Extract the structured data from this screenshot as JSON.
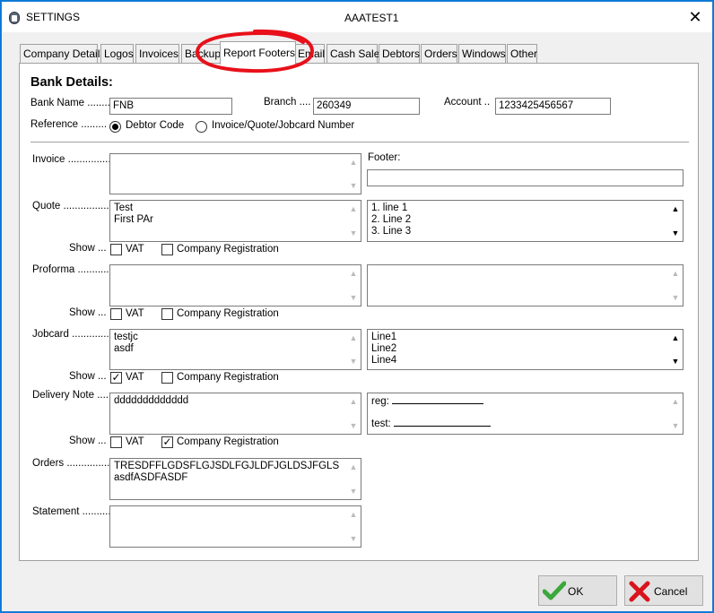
{
  "window": {
    "title": "SETTINGS",
    "company": "AAATEST1",
    "close_glyph": "✕"
  },
  "tabs": [
    {
      "label": "Company Details"
    },
    {
      "label": "Logos"
    },
    {
      "label": "Invoices"
    },
    {
      "label": "Backup"
    },
    {
      "label": "Report Footers",
      "active": true
    },
    {
      "label": "Email"
    },
    {
      "label": "Cash Sale"
    },
    {
      "label": "Debtors"
    },
    {
      "label": "Orders"
    },
    {
      "label": "Windows"
    },
    {
      "label": "Other"
    }
  ],
  "bank": {
    "heading": "Bank Details:",
    "name_label": "Bank Name ........",
    "name_value": "FNB",
    "branch_label": "Branch ....",
    "branch_value": "260349",
    "account_label": "Account ..",
    "account_value": "1233425456567",
    "reference_label": "Reference .........",
    "reference_options": [
      "Debtor Code",
      "Invoice/Quote/Jobcard Number"
    ],
    "reference_selected": "Debtor Code"
  },
  "footers": {
    "footer_label": "Footer:",
    "invoice": {
      "label": "Invoice ...............",
      "text": [],
      "footer_value": ""
    },
    "quote": {
      "label": "Quote ..................",
      "text": [
        "Test",
        "First PAr"
      ],
      "footer_text": [
        "1. line 1",
        "2. Line 2",
        "3. Line 3"
      ],
      "show_label": "Show ...",
      "vat_label": "VAT",
      "vat_checked": false,
      "reg_label": "Company Registration",
      "reg_checked": false
    },
    "proforma": {
      "label": "Proforma ............",
      "text": [],
      "footer_text": [],
      "show_label": "Show ...",
      "vat_label": "VAT",
      "vat_checked": false,
      "reg_label": "Company Registration",
      "reg_checked": false
    },
    "jobcard": {
      "label": "Jobcard ..............",
      "text": [
        "testjc",
        "asdf"
      ],
      "footer_text": [
        "Line1",
        "Line2",
        "Line4"
      ],
      "show_label": "Show ...",
      "vat_label": "VAT",
      "vat_checked": true,
      "reg_label": "Company Registration",
      "reg_checked": false
    },
    "delivery": {
      "label": "Delivery Note ......",
      "text": [
        "ddddddddddddd"
      ],
      "footer_text": [
        "reg:",
        "test:"
      ],
      "show_label": "Show ...",
      "vat_label": "VAT",
      "vat_checked": false,
      "reg_label": "Company Registration",
      "reg_checked": true
    },
    "orders": {
      "label": "Orders ..................",
      "text": [
        "TRESDFFLGDSFLGJSDLFGJLDFJGLDSJFGLS",
        "asdfASDFASDF"
      ]
    },
    "statement": {
      "label": "Statement ...........",
      "text": []
    }
  },
  "buttons": {
    "ok_label": "OK",
    "cancel_label": "Cancel"
  },
  "colors": {
    "accent": "#0a78d7",
    "annotation": "#e8101a",
    "ok_check": "#3aa83a",
    "cancel_x": "#d8141c"
  }
}
